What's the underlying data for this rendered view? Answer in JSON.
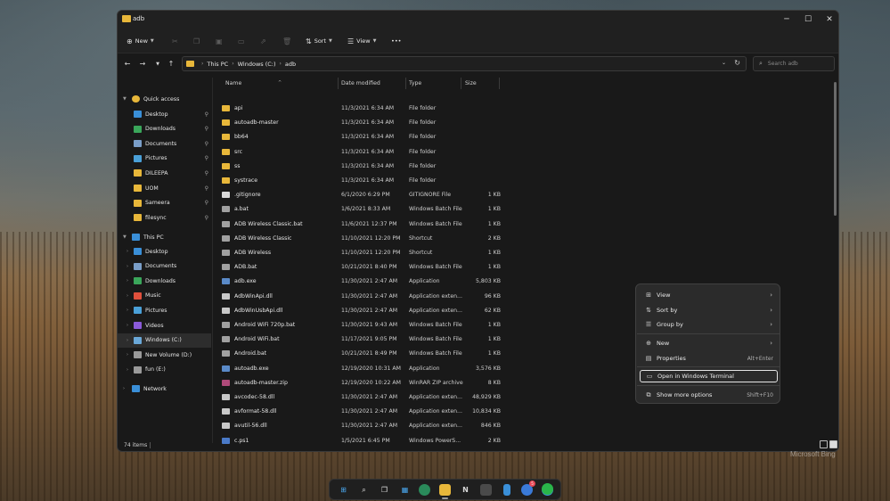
{
  "window": {
    "title": "adb",
    "controls": {
      "minimize": "─",
      "maximize": "☐",
      "close": "✕"
    }
  },
  "toolbar": {
    "new_label": "New",
    "sort_label": "Sort",
    "view_label": "View",
    "more_label": "•••"
  },
  "address": {
    "crumbs": [
      "This PC",
      "Windows (C:)",
      "adb"
    ],
    "search_placeholder": "Search adb"
  },
  "sidebar": {
    "quick_access": "Quick access",
    "quick_items": [
      {
        "label": "Desktop",
        "icon": "desktop-icon",
        "color": "#3a8fd8"
      },
      {
        "label": "Downloads",
        "icon": "download-icon",
        "color": "#3aa65a"
      },
      {
        "label": "Documents",
        "icon": "document-icon",
        "color": "#7a9ec8"
      },
      {
        "label": "Pictures",
        "icon": "picture-icon",
        "color": "#4aa0d8"
      },
      {
        "label": "DILEEPA",
        "icon": "folder-icon",
        "color": "#e8b73a"
      },
      {
        "label": "UOM",
        "icon": "folder-icon",
        "color": "#e8b73a"
      },
      {
        "label": "Sameera",
        "icon": "folder-icon",
        "color": "#e8b73a"
      },
      {
        "label": "filesync",
        "icon": "folder-icon",
        "color": "#e8b73a"
      }
    ],
    "this_pc": "This PC",
    "pc_items": [
      {
        "label": "Desktop",
        "icon": "desktop-icon",
        "color": "#3a8fd8"
      },
      {
        "label": "Documents",
        "icon": "document-icon",
        "color": "#7a9ec8"
      },
      {
        "label": "Downloads",
        "icon": "download-icon",
        "color": "#3aa65a"
      },
      {
        "label": "Music",
        "icon": "music-icon",
        "color": "#e0503c"
      },
      {
        "label": "Pictures",
        "icon": "picture-icon",
        "color": "#4aa0d8"
      },
      {
        "label": "Videos",
        "icon": "video-icon",
        "color": "#8a5ad8"
      },
      {
        "label": "Windows (C:)",
        "icon": "drive-icon",
        "color": "#6aa8d8"
      },
      {
        "label": "New Volume (D:)",
        "icon": "drive-icon",
        "color": "#9a9a9a"
      },
      {
        "label": "fun (E:)",
        "icon": "drive-icon",
        "color": "#9a9a9a"
      }
    ],
    "network": "Network"
  },
  "columns": {
    "name": "Name",
    "date": "Date modified",
    "type": "Type",
    "size": "Size"
  },
  "files": [
    {
      "name": "api",
      "date": "11/3/2021 6:34 AM",
      "type": "File folder",
      "size": "",
      "color": "#e8b73a"
    },
    {
      "name": "autoadb-master",
      "date": "11/3/2021 6:34 AM",
      "type": "File folder",
      "size": "",
      "color": "#e8b73a"
    },
    {
      "name": "bb64",
      "date": "11/3/2021 6:34 AM",
      "type": "File folder",
      "size": "",
      "color": "#e8b73a"
    },
    {
      "name": "src",
      "date": "11/3/2021 6:34 AM",
      "type": "File folder",
      "size": "",
      "color": "#e8b73a"
    },
    {
      "name": "ss",
      "date": "11/3/2021 6:34 AM",
      "type": "File folder",
      "size": "",
      "color": "#e8b73a"
    },
    {
      "name": "systrace",
      "date": "11/3/2021 6:34 AM",
      "type": "File folder",
      "size": "",
      "color": "#e8b73a"
    },
    {
      "name": ".gitignore",
      "date": "6/1/2020 6:29 PM",
      "type": "GITIGNORE File",
      "size": "1 KB",
      "color": "#d8d8d8"
    },
    {
      "name": "a.bat",
      "date": "1/6/2021 8:33 AM",
      "type": "Windows Batch File",
      "size": "1 KB",
      "color": "#a0a0a0"
    },
    {
      "name": "ADB Wireless Classic.bat",
      "date": "11/6/2021 12:37 PM",
      "type": "Windows Batch File",
      "size": "1 KB",
      "color": "#a0a0a0"
    },
    {
      "name": "ADB Wireless Classic",
      "date": "11/10/2021 12:20 PM",
      "type": "Shortcut",
      "size": "2 KB",
      "color": "#a0a0a0"
    },
    {
      "name": "ADB Wireless",
      "date": "11/10/2021 12:20 PM",
      "type": "Shortcut",
      "size": "1 KB",
      "color": "#a0a0a0"
    },
    {
      "name": "ADB.bat",
      "date": "10/21/2021 8:40 PM",
      "type": "Windows Batch File",
      "size": "1 KB",
      "color": "#a0a0a0"
    },
    {
      "name": "adb.exe",
      "date": "11/30/2021 2:47 AM",
      "type": "Application",
      "size": "5,803 KB",
      "color": "#5a8ac8"
    },
    {
      "name": "AdbWinApi.dll",
      "date": "11/30/2021 2:47 AM",
      "type": "Application exten...",
      "size": "96 KB",
      "color": "#c8c8c8"
    },
    {
      "name": "AdbWinUsbApi.dll",
      "date": "11/30/2021 2:47 AM",
      "type": "Application exten...",
      "size": "62 KB",
      "color": "#c8c8c8"
    },
    {
      "name": "Android WiFi 720p.bat",
      "date": "11/30/2021 9:43 AM",
      "type": "Windows Batch File",
      "size": "1 KB",
      "color": "#a0a0a0"
    },
    {
      "name": "Android WiFi.bat",
      "date": "11/17/2021 9:05 PM",
      "type": "Windows Batch File",
      "size": "1 KB",
      "color": "#a0a0a0"
    },
    {
      "name": "Android.bat",
      "date": "10/21/2021 8:49 PM",
      "type": "Windows Batch File",
      "size": "1 KB",
      "color": "#a0a0a0"
    },
    {
      "name": "autoadb.exe",
      "date": "12/19/2020 10:31 AM",
      "type": "Application",
      "size": "3,576 KB",
      "color": "#5a8ac8"
    },
    {
      "name": "autoadb-master.zip",
      "date": "12/19/2020 10:22 AM",
      "type": "WinRAR ZIP archive",
      "size": "8 KB",
      "color": "#b04a7a"
    },
    {
      "name": "avcodec-58.dll",
      "date": "11/30/2021 2:47 AM",
      "type": "Application exten...",
      "size": "48,929 KB",
      "color": "#c8c8c8"
    },
    {
      "name": "avformat-58.dll",
      "date": "11/30/2021 2:47 AM",
      "type": "Application exten...",
      "size": "10,834 KB",
      "color": "#c8c8c8"
    },
    {
      "name": "avutil-56.dll",
      "date": "11/30/2021 2:47 AM",
      "type": "Application exten...",
      "size": "846 KB",
      "color": "#c8c8c8"
    },
    {
      "name": "c.ps1",
      "date": "1/5/2021 6:45 PM",
      "type": "Windows PowerS...",
      "size": "2 KB",
      "color": "#4a7ac8"
    }
  ],
  "status": {
    "count": "74 items"
  },
  "context_menu": {
    "items": [
      {
        "label": "View",
        "icon": "grid-icon",
        "glyph": "⊞",
        "shortcut": "",
        "arrow": "›"
      },
      {
        "label": "Sort by",
        "icon": "sort-icon",
        "glyph": "⇅",
        "shortcut": "",
        "arrow": "›"
      },
      {
        "label": "Group by",
        "icon": "group-icon",
        "glyph": "☰",
        "shortcut": "",
        "arrow": "›"
      },
      {
        "label": "New",
        "icon": "plus-circle-icon",
        "glyph": "⊕",
        "shortcut": "",
        "arrow": "›"
      },
      {
        "label": "Properties",
        "icon": "properties-icon",
        "glyph": "▤",
        "shortcut": "Alt+Enter",
        "arrow": ""
      },
      {
        "label": "Open in Windows Terminal",
        "icon": "terminal-icon",
        "glyph": "▭",
        "shortcut": "",
        "arrow": ""
      },
      {
        "label": "Show more options",
        "icon": "more-options-icon",
        "glyph": "⧉",
        "shortcut": "Shift+F10",
        "arrow": ""
      }
    ]
  },
  "taskbar": {
    "badge": "5"
  },
  "watermark": "Microsoft Bing"
}
